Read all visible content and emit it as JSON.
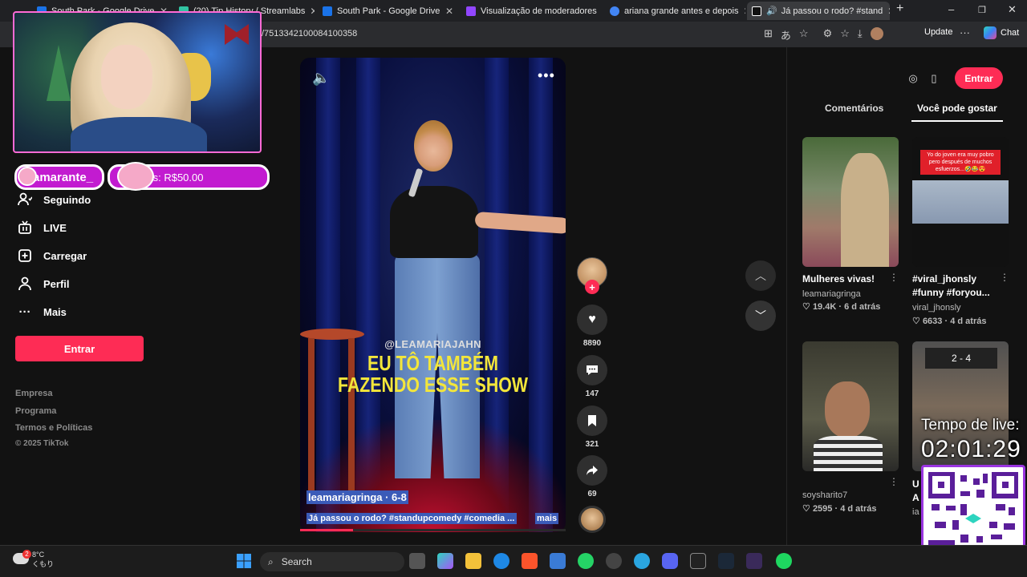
{
  "tabs": [
    {
      "title": "South Park - Google Drive",
      "color": "#1a73e8"
    },
    {
      "title": "(20) Tip History / Streamlabs",
      "color": "#31c3a2"
    },
    {
      "title": "South Park - Google Drive",
      "color": "#1a73e8"
    },
    {
      "title": "Visualização de moderadores",
      "color": "#9146ff"
    },
    {
      "title": "ariana grande antes e depois",
      "color": "#4285f4"
    },
    {
      "title": "Já passou o rodo? #stand",
      "color": "#ffffff"
    }
  ],
  "address_bar": {
    "url": "/7513342100084100358",
    "update_label": "Update",
    "chat_label": "Chat"
  },
  "sidebar": {
    "items": [
      {
        "label": "Seguindo",
        "icon": "following-icon"
      },
      {
        "label": "LIVE",
        "icon": "live-icon"
      },
      {
        "label": "Carregar",
        "icon": "upload-icon"
      },
      {
        "label": "Perfil",
        "icon": "profile-icon"
      },
      {
        "label": "Mais",
        "icon": "more-icon"
      }
    ],
    "login_button": "Entrar",
    "footer_links": [
      "Empresa",
      "Programa",
      "Termos e Políticas"
    ],
    "copyright": "© 2025 TikTok"
  },
  "stream_overlay": {
    "subscriber_name": "amarante_",
    "tip_text": "ts: R$50.00",
    "live_timer_label": "Tempo de live:",
    "live_timer_value": "02:01:29"
  },
  "video": {
    "handle_overlay": "@LEAMARIAJAHN",
    "caption_line1": "EU TÔ TAMBÉM",
    "caption_line2": "FAZENDO ESSE SHOW",
    "author_line": "leamariagringa · 6-8",
    "description": "Já passou o rodo? #standupcomedy #comedia ...",
    "more_label": "mais",
    "progress": 0.2
  },
  "actions": {
    "likes": "8890",
    "comments": "147",
    "saves": "321",
    "shares": "69"
  },
  "right_panel": {
    "login_button": "Entrar",
    "tabs": [
      "Comentários",
      "Você pode gostar"
    ],
    "recommendations": [
      {
        "title": "Mulheres vivas!",
        "author": "leamariagringa",
        "likes": "19.4K",
        "age": "6 d atrás"
      },
      {
        "title": "#viral_jhonsly #funny #foryou...",
        "author": "viral_jhonsly",
        "likes": "6633",
        "age": "4 d atrás",
        "thumb_text": "Yo do joven era muy pobro pero después de muchos esfuerzos...🤣😂😍"
      },
      {
        "title": "",
        "author": "soysharito7",
        "likes": "2595",
        "age": "4 d atrás"
      },
      {
        "title": "U A",
        "author": "ia",
        "likes": "",
        "age": ""
      }
    ]
  },
  "taskbar": {
    "temperature": "8°C",
    "weather_text": "くもり",
    "weather_badge": "2",
    "search_placeholder": "Search"
  },
  "colors": {
    "accent": "#fe2c55",
    "overlay_purple": "#c21bd0",
    "selection_blue": "#3b5bb8"
  }
}
